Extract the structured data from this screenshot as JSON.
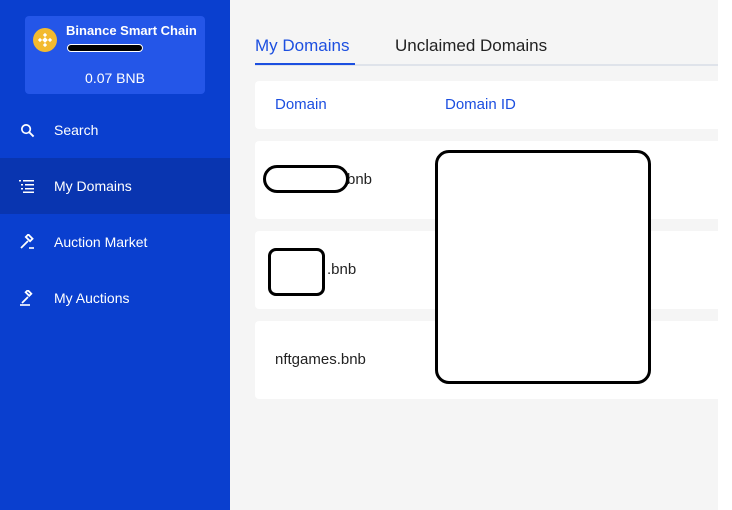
{
  "sidebar": {
    "wallet": {
      "chain_name": "Binance Smart Chain",
      "balance": "0.07 BNB",
      "logo_icon": "binance-coin-icon"
    },
    "items": [
      {
        "label": "Search",
        "icon": "search-icon",
        "active": false
      },
      {
        "label": "My Domains",
        "icon": "list-icon",
        "active": true
      },
      {
        "label": "Auction Market",
        "icon": "hammer-icon",
        "active": false
      },
      {
        "label": "My Auctions",
        "icon": "gavel-icon",
        "active": false
      }
    ]
  },
  "main": {
    "tabs": [
      {
        "label": "My Domains",
        "active": true
      },
      {
        "label": "Unclaimed Domains",
        "active": false
      }
    ],
    "table": {
      "columns": [
        "Domain",
        "Domain ID"
      ],
      "rows": [
        {
          "domain_suffix": "bnb",
          "redacted": true
        },
        {
          "domain_suffix": ".bnb",
          "redacted": true
        },
        {
          "domain": "nftgames.bnb",
          "redacted": false
        }
      ]
    }
  },
  "colors": {
    "sidebar_bg": "#0a3fcf",
    "sidebar_active_bg": "#0935b0",
    "wallet_card_bg": "#2456e8",
    "accent_blue": "#1c4fe0",
    "main_bg": "#f5f5f5",
    "binance_yellow": "#f3ba2f"
  }
}
